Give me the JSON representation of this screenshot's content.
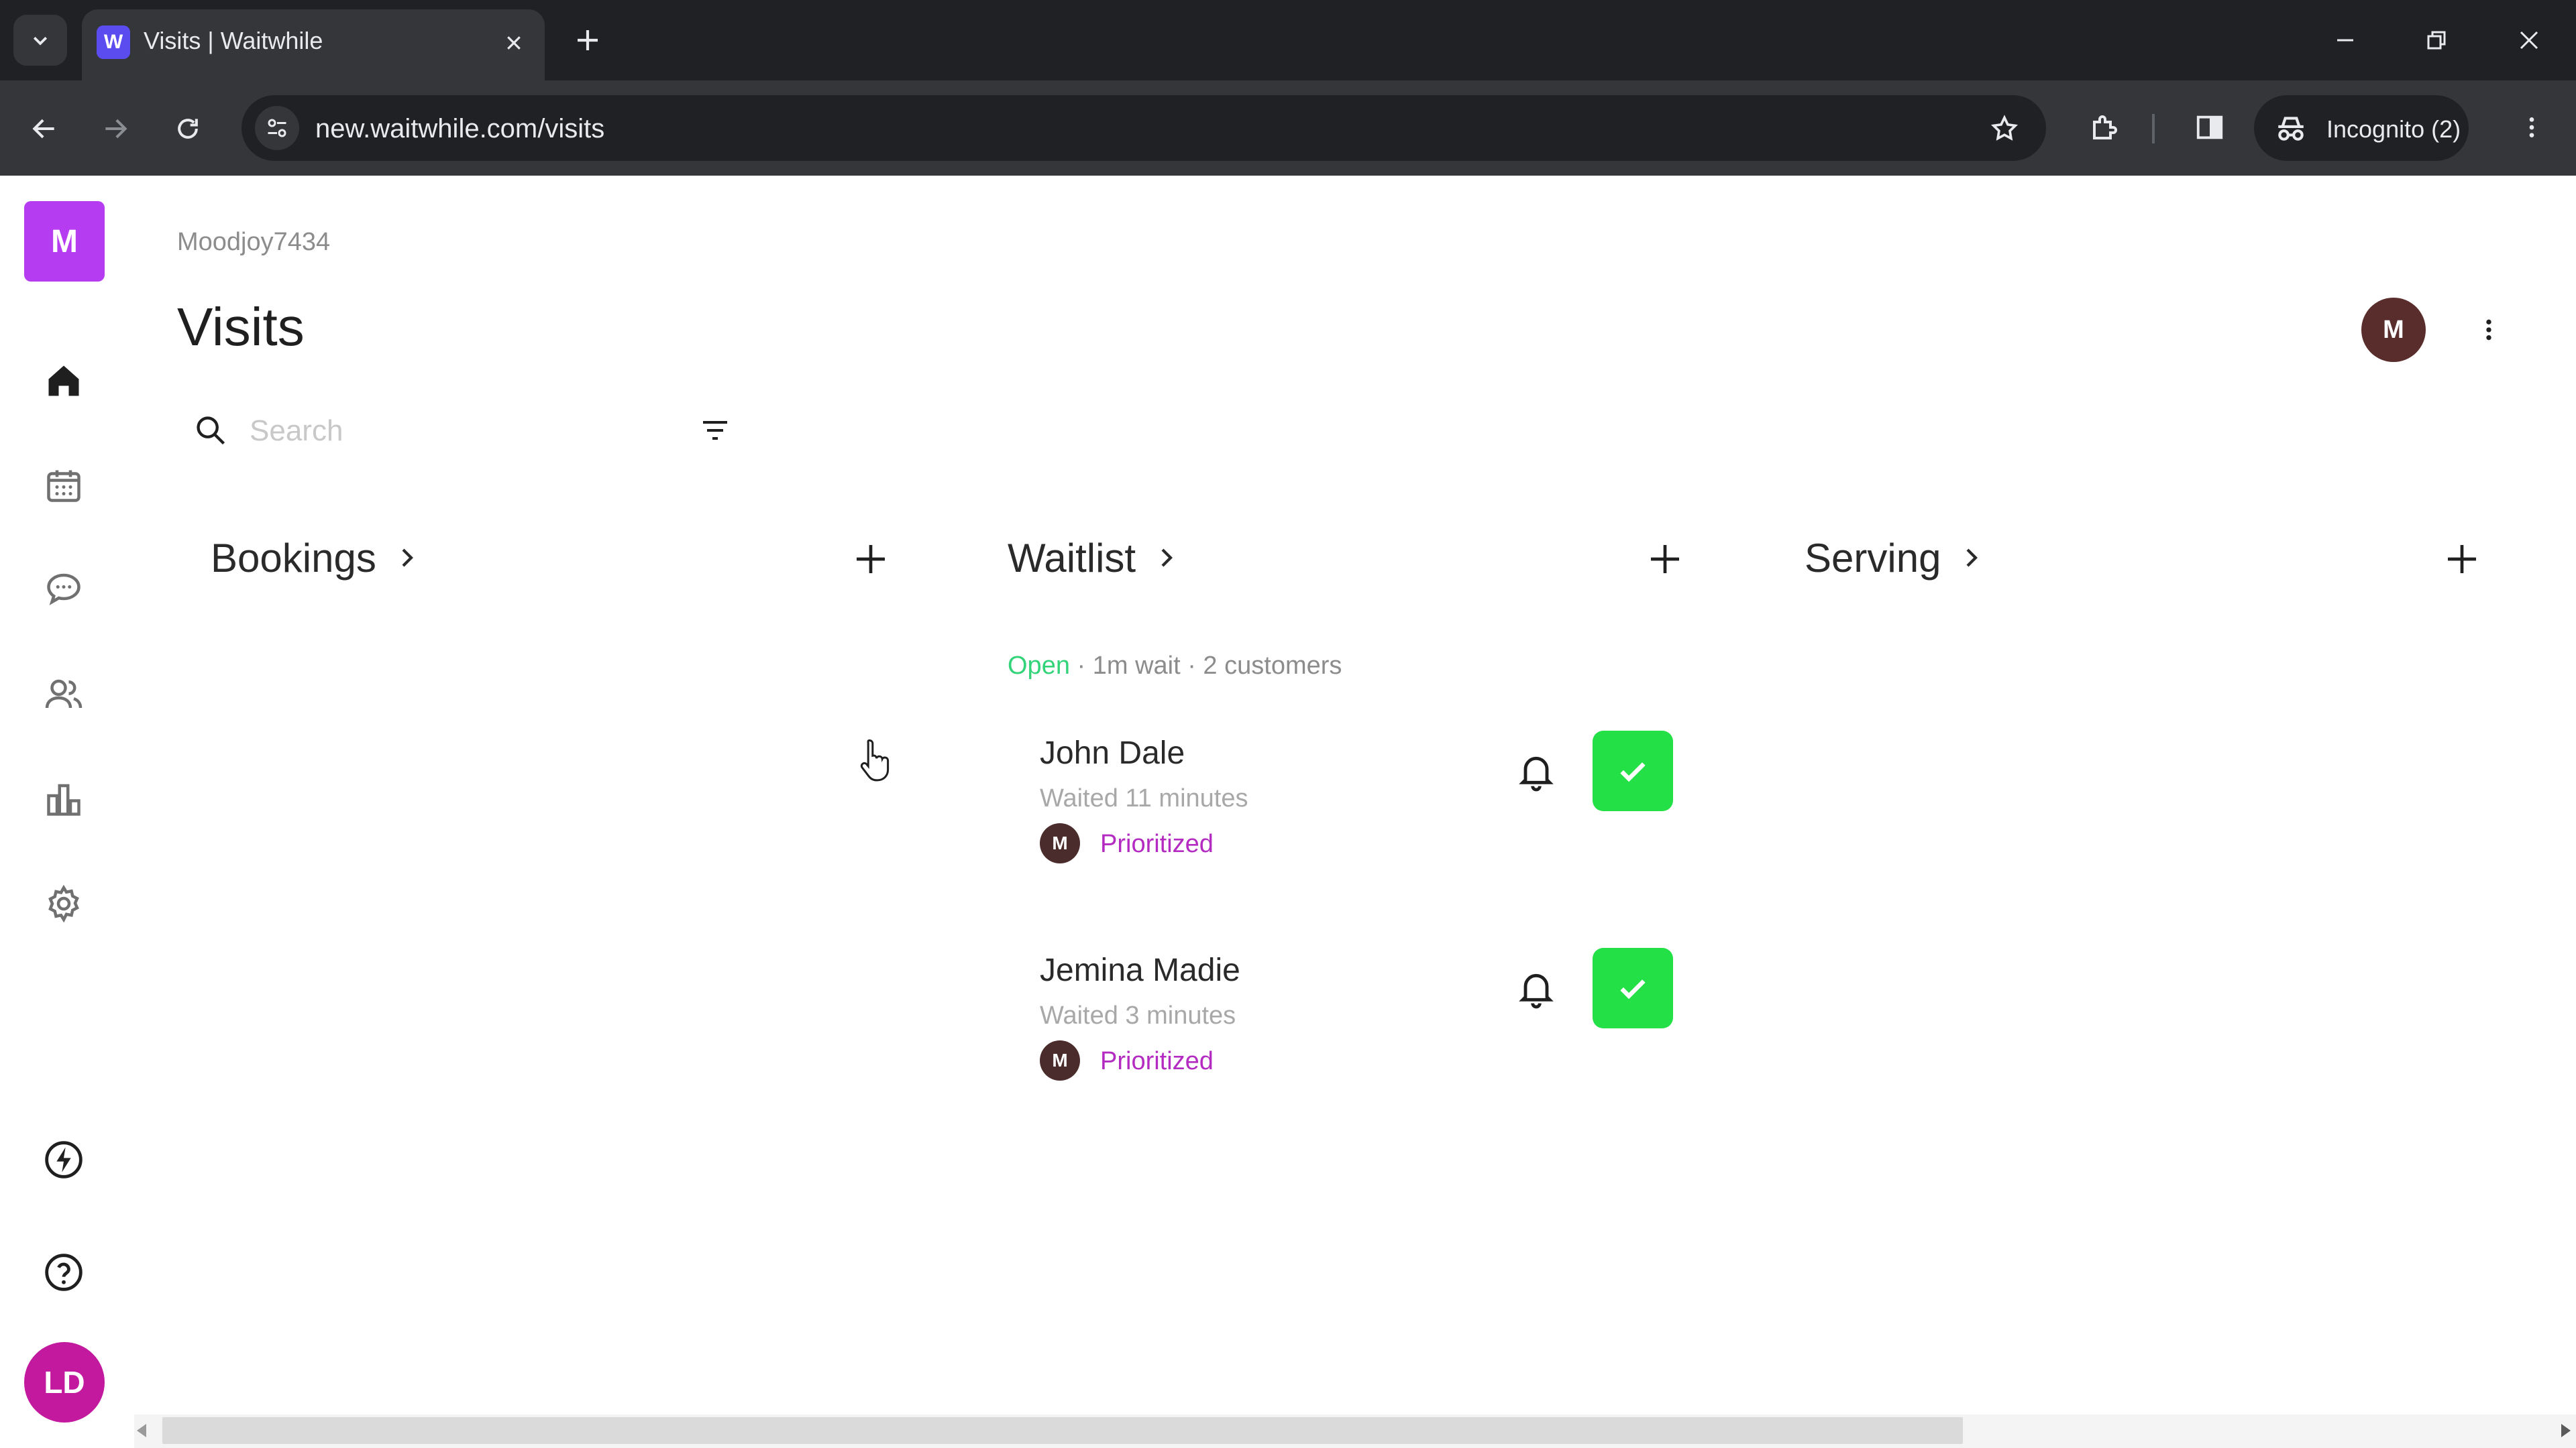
{
  "browser": {
    "tab_title": "Visits | Waitwhile",
    "favicon_letter": "W",
    "url": "new.waitwhile.com/visits",
    "incognito_label": "Incognito (2)"
  },
  "sidebar": {
    "workspace_initial": "M",
    "user_initials": "LD",
    "items": [
      "home-icon",
      "calendar-icon",
      "chat-icon",
      "users-icon",
      "analytics-icon",
      "settings-icon",
      "bolt-icon",
      "help-icon"
    ]
  },
  "header": {
    "workspace_name": "Moodjoy7434",
    "title": "Visits",
    "avatar_initial": "M"
  },
  "search": {
    "placeholder": "Search"
  },
  "columns": {
    "bookings": {
      "name": "Bookings"
    },
    "waitlist": {
      "name": "Waitlist",
      "status_open": "Open",
      "status_rest": " · 1m wait · 2 customers"
    },
    "serving": {
      "name": "Serving"
    }
  },
  "waitlist_visits": [
    {
      "name": "John Dale",
      "waited": "Waited 11 minutes",
      "staff_initial": "M",
      "tag": "Prioritized"
    },
    {
      "name": "Jemina Madie",
      "waited": "Waited 3 minutes",
      "staff_initial": "M",
      "tag": "Prioritized"
    }
  ],
  "colors": {
    "workspace_avatar": "#b63cf2",
    "user_avatar": "#c3199f",
    "open_status": "#33d37a",
    "prioritized_tag": "#b32bc0",
    "serve_button": "#22e046"
  }
}
